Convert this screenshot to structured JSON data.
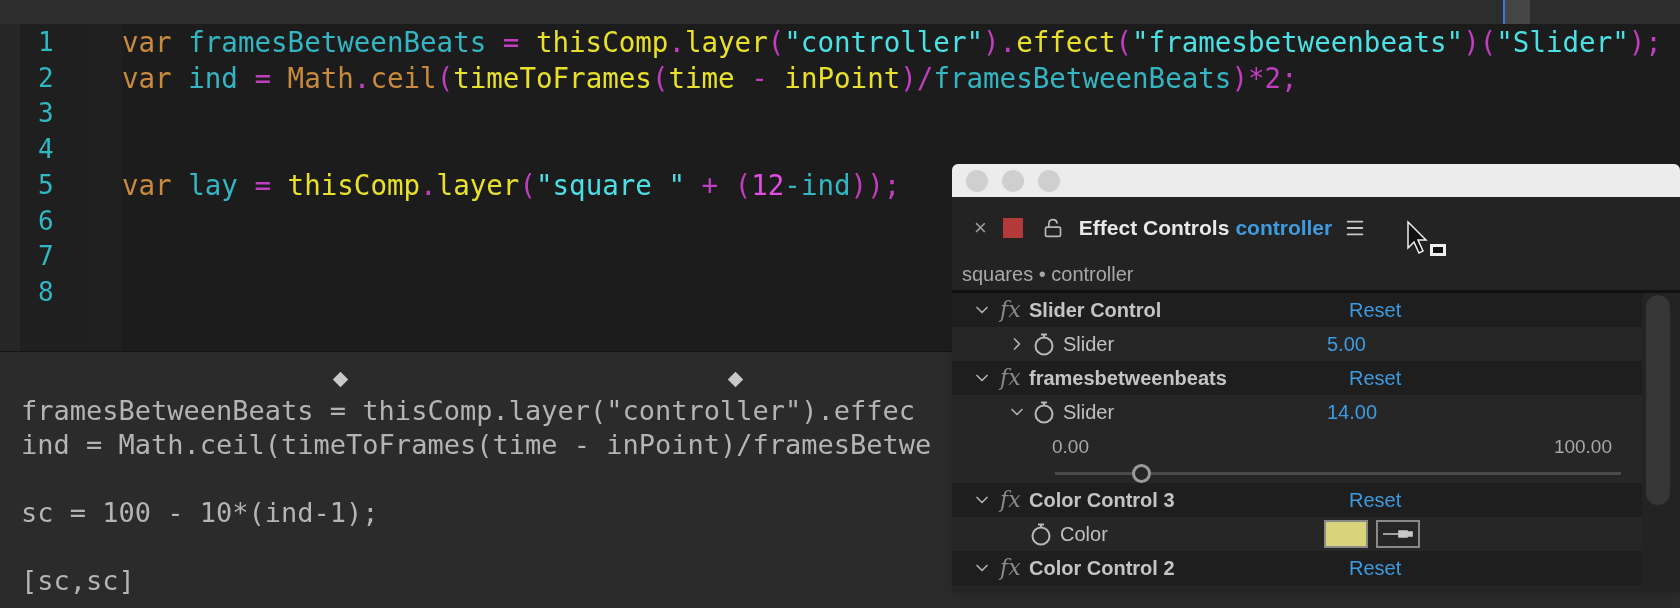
{
  "editor": {
    "lines": [
      {
        "number": "1",
        "tokens": [
          {
            "text": "var ",
            "color": "#c98a3e"
          },
          {
            "text": "framesBetweenBeats ",
            "color": "#33b6c2"
          },
          {
            "text": "= ",
            "color": "#c13ec1"
          },
          {
            "text": "thisComp",
            "color": "#e8e12c"
          },
          {
            "text": ".",
            "color": "#c13ec1"
          },
          {
            "text": "layer",
            "color": "#e8e12c"
          },
          {
            "text": "(",
            "color": "#c13ec1"
          },
          {
            "text": "\"controller\"",
            "color": "#4be0e3"
          },
          {
            "text": ").",
            "color": "#c13ec1"
          },
          {
            "text": "effect",
            "color": "#e8e12c"
          },
          {
            "text": "(",
            "color": "#c13ec1"
          },
          {
            "text": "\"framesbetweenbeats\"",
            "color": "#4be0e3"
          },
          {
            "text": ")(",
            "color": "#c13ec1"
          },
          {
            "text": "\"Slider\"",
            "color": "#4be0e3"
          },
          {
            "text": ");",
            "color": "#c13ec1"
          }
        ]
      },
      {
        "number": "2",
        "tokens": [
          {
            "text": "var ",
            "color": "#c98a3e"
          },
          {
            "text": "ind ",
            "color": "#33b6c2"
          },
          {
            "text": "= ",
            "color": "#c13ec1"
          },
          {
            "text": "Math",
            "color": "#c98a3e"
          },
          {
            "text": ".",
            "color": "#c13ec1"
          },
          {
            "text": "ceil",
            "color": "#c98a3e"
          },
          {
            "text": "(",
            "color": "#c13ec1"
          },
          {
            "text": "timeToFrames",
            "color": "#e8e12c"
          },
          {
            "text": "(",
            "color": "#c13ec1"
          },
          {
            "text": "time ",
            "color": "#e8e12c"
          },
          {
            "text": "- ",
            "color": "#c13ec1"
          },
          {
            "text": "inPoint",
            "color": "#e8e12c"
          },
          {
            "text": ")/",
            "color": "#c13ec1"
          },
          {
            "text": "framesBetweenBeats",
            "color": "#33b6c2"
          },
          {
            "text": ")*2;",
            "color": "#c13ec1"
          }
        ]
      },
      {
        "number": "3"
      },
      {
        "number": "4"
      },
      {
        "number": "5",
        "tokens": [
          {
            "text": "var ",
            "color": "#c98a3e"
          },
          {
            "text": "lay ",
            "color": "#33b6c2"
          },
          {
            "text": "= ",
            "color": "#c13ec1"
          },
          {
            "text": "thisComp",
            "color": "#e8e12c"
          },
          {
            "text": ".",
            "color": "#c13ec1"
          },
          {
            "text": "layer",
            "color": "#e8e12c"
          },
          {
            "text": "(",
            "color": "#c13ec1"
          },
          {
            "text": "\"square \"",
            "color": "#4be0e3"
          },
          {
            "text": " + (",
            "color": "#c13ec1"
          },
          {
            "text": "12",
            "color": "#e24ee2"
          },
          {
            "text": "-ind",
            "color": "#33b6c2"
          },
          {
            "text": "));",
            "color": "#c13ec1"
          }
        ]
      },
      {
        "number": "6"
      },
      {
        "number": "7"
      },
      {
        "number": "8"
      }
    ]
  },
  "output": {
    "blocks": [
      [
        "framesBetweenBeats = thisComp.layer(\"controller\").effec",
        "ind = Math.ceil(timeToFrames(time - inPoint)/framesBetwe"
      ],
      [
        "sc = 100 - 10*(ind-1);"
      ],
      [
        "[sc,sc]"
      ]
    ]
  },
  "panel": {
    "close": "×",
    "title": "Effect Controls",
    "target": "controller",
    "breadcrumb": "squares • controller",
    "rows": [
      {
        "kind": "effect",
        "fx": "fx",
        "name": "Slider Control",
        "expanded": true,
        "action": "Reset"
      },
      {
        "kind": "param",
        "label": "Slider",
        "value": "5.00",
        "expanded": false
      },
      {
        "kind": "effect",
        "fx": "fx",
        "name": "framesbetweenbeats",
        "expanded": true,
        "action": "Reset"
      },
      {
        "kind": "param",
        "label": "Slider",
        "value": "14.00",
        "expanded": true
      },
      {
        "kind": "range",
        "min": "0.00",
        "max": "100.00",
        "level": 0.14
      },
      {
        "kind": "effect",
        "fx": "fx",
        "name": "Color Control 3",
        "expanded": true,
        "action": "Reset"
      },
      {
        "kind": "color",
        "label": "Color",
        "color": "#d8d47a"
      },
      {
        "kind": "effect",
        "fx": "fx",
        "name": "Color Control 2",
        "expanded": true,
        "action": "Reset"
      }
    ]
  }
}
